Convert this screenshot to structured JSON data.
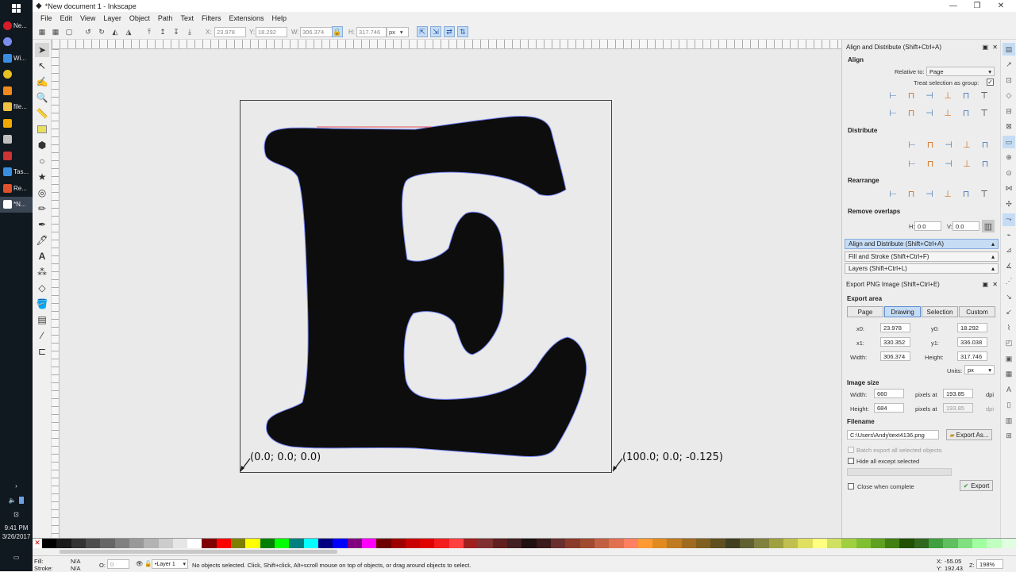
{
  "taskbar": {
    "items": [
      {
        "label": "Ne...",
        "icon": "opera-icon",
        "color": "#d61d2a"
      },
      {
        "label": "",
        "icon": "browser-icon",
        "color": "#7b8ef0"
      },
      {
        "label": "Wi...",
        "icon": "window-icon",
        "color": "#3a8ee0"
      },
      {
        "label": "",
        "icon": "chrome-icon",
        "color": "#e8c020"
      },
      {
        "label": "",
        "icon": "vlc-icon",
        "color": "#f08a1c"
      },
      {
        "label": "file...",
        "icon": "folder-icon",
        "color": "#f0c040"
      },
      {
        "label": "",
        "icon": "app-icon",
        "color": "#f0a800"
      },
      {
        "label": "",
        "icon": "calculator-icon",
        "color": "#c0c0c0"
      },
      {
        "label": "",
        "icon": "app-icon",
        "color": "#cc3333"
      },
      {
        "label": "Tas...",
        "icon": "task-icon",
        "color": "#3a8ee0"
      },
      {
        "label": "Re...",
        "icon": "recorder-icon",
        "color": "#e0502a"
      },
      {
        "label": "*N...",
        "icon": "inkscape-icon",
        "color": "#ffffff"
      }
    ],
    "time": "9:41 PM",
    "date": "3/26/2017"
  },
  "window": {
    "title": "*New document 1 - Inkscape",
    "minimize": "—",
    "maximize": "❐",
    "close": "✕"
  },
  "menu": [
    "File",
    "Edit",
    "View",
    "Layer",
    "Object",
    "Path",
    "Text",
    "Filters",
    "Extensions",
    "Help"
  ],
  "toolbar": {
    "x_label": "X:",
    "x": "23.978",
    "y_label": "Y:",
    "y": "18.292",
    "w_label": "W:",
    "w": "306.374",
    "h_label": "H:",
    "h": "317.746",
    "units": "px"
  },
  "canvas": {
    "glyph": "E",
    "coord_left": "(0.0; 0.0; 0.0)",
    "coord_right": "(100.0; 0.0; -0.125)"
  },
  "align": {
    "panel_title": "Align and Distribute (Shift+Ctrl+A)",
    "section": "Align",
    "relative_to_label": "Relative to:",
    "relative_to": "Page",
    "treat_group": "Treat selection as group:",
    "distribute": "Distribute",
    "rearrange": "Rearrange",
    "remove_overlaps": "Remove overlaps",
    "h_label": "H:",
    "h": "0.0",
    "v_label": "V:",
    "v": "0.0"
  },
  "dock_tabs": [
    {
      "label": "Align and Distribute (Shift+Ctrl+A)",
      "active": true
    },
    {
      "label": "Fill and Stroke (Shift+Ctrl+F)",
      "active": false
    },
    {
      "label": "Layers (Shift+Ctrl+L)",
      "active": false
    }
  ],
  "export": {
    "panel_title": "Export PNG Image (Shift+Ctrl+E)",
    "area": "Export area",
    "buttons": [
      "Page",
      "Drawing",
      "Selection",
      "Custom"
    ],
    "x0_label": "x0:",
    "x0": "23.978",
    "y0_label": "y0:",
    "y0": "18.292",
    "x1_label": "x1:",
    "x1": "330.352",
    "y1_label": "y1:",
    "y1": "336.038",
    "width_label": "Width:",
    "width": "306.374",
    "height_label": "Height:",
    "height": "317.746",
    "units_label": "Units:",
    "units": "px",
    "image_size": "Image size",
    "img_width_label": "Width:",
    "img_width": "660",
    "img_height_label": "Height:",
    "img_height": "684",
    "pixels_at": "pixels at",
    "dpi1": "193.85",
    "dpi2": "193.85",
    "dpi": "dpi",
    "filename_label": "Filename",
    "filename": "C:\\Users\\Andy\\text4136.png",
    "export_as": "Export As...",
    "batch": "Batch export all selected objects",
    "hide_all": "Hide all except selected",
    "close_when": "Close when complete",
    "export": "Export"
  },
  "status": {
    "fill_label": "Fill:",
    "fill": "N/A",
    "stroke_label": "Stroke:",
    "stroke": "N/A",
    "o_label": "O:",
    "o": "0",
    "layer": "•Layer 1",
    "message": "No objects selected. Click, Shift+click, Alt+scroll mouse on top of objects, or drag around objects to select.",
    "x_label": "X:",
    "x": "-55.05",
    "y_label": "Y:",
    "y": "192.43",
    "z_label": "Z:",
    "zoom": "198%"
  },
  "palette": [
    "#000000",
    "#1a1a1a",
    "#333333",
    "#4d4d4d",
    "#666666",
    "#808080",
    "#999999",
    "#b3b3b3",
    "#cccccc",
    "#e6e6e6",
    "#ffffff",
    "#800000",
    "#ff0000",
    "#808000",
    "#ffff00",
    "#008000",
    "#00ff00",
    "#008080",
    "#00ffff",
    "#000080",
    "#0000ff",
    "#800080",
    "#ff00ff",
    "#6e0000",
    "#9e0000",
    "#c80000",
    "#e00000",
    "#f21c1c",
    "#ff4040",
    "#a02020",
    "#803030",
    "#602020",
    "#402020",
    "#201010",
    "#3a1a1a",
    "#6b2e2e",
    "#8a3a2a",
    "#a04a30",
    "#c06040",
    "#e07050",
    "#ff8060",
    "#ff9a30",
    "#e08a20",
    "#c07a20",
    "#a06a20",
    "#806020",
    "#605020",
    "#404020",
    "#606030",
    "#808040",
    "#a0a040",
    "#c0c050",
    "#e0e060",
    "#ffff80",
    "#d0e060",
    "#a0d040",
    "#80c030",
    "#60a020",
    "#408010",
    "#205000",
    "#306820",
    "#40a040",
    "#60c060",
    "#80e080",
    "#a0ffa0",
    "#c0ffc0",
    "#e0ffe0"
  ]
}
